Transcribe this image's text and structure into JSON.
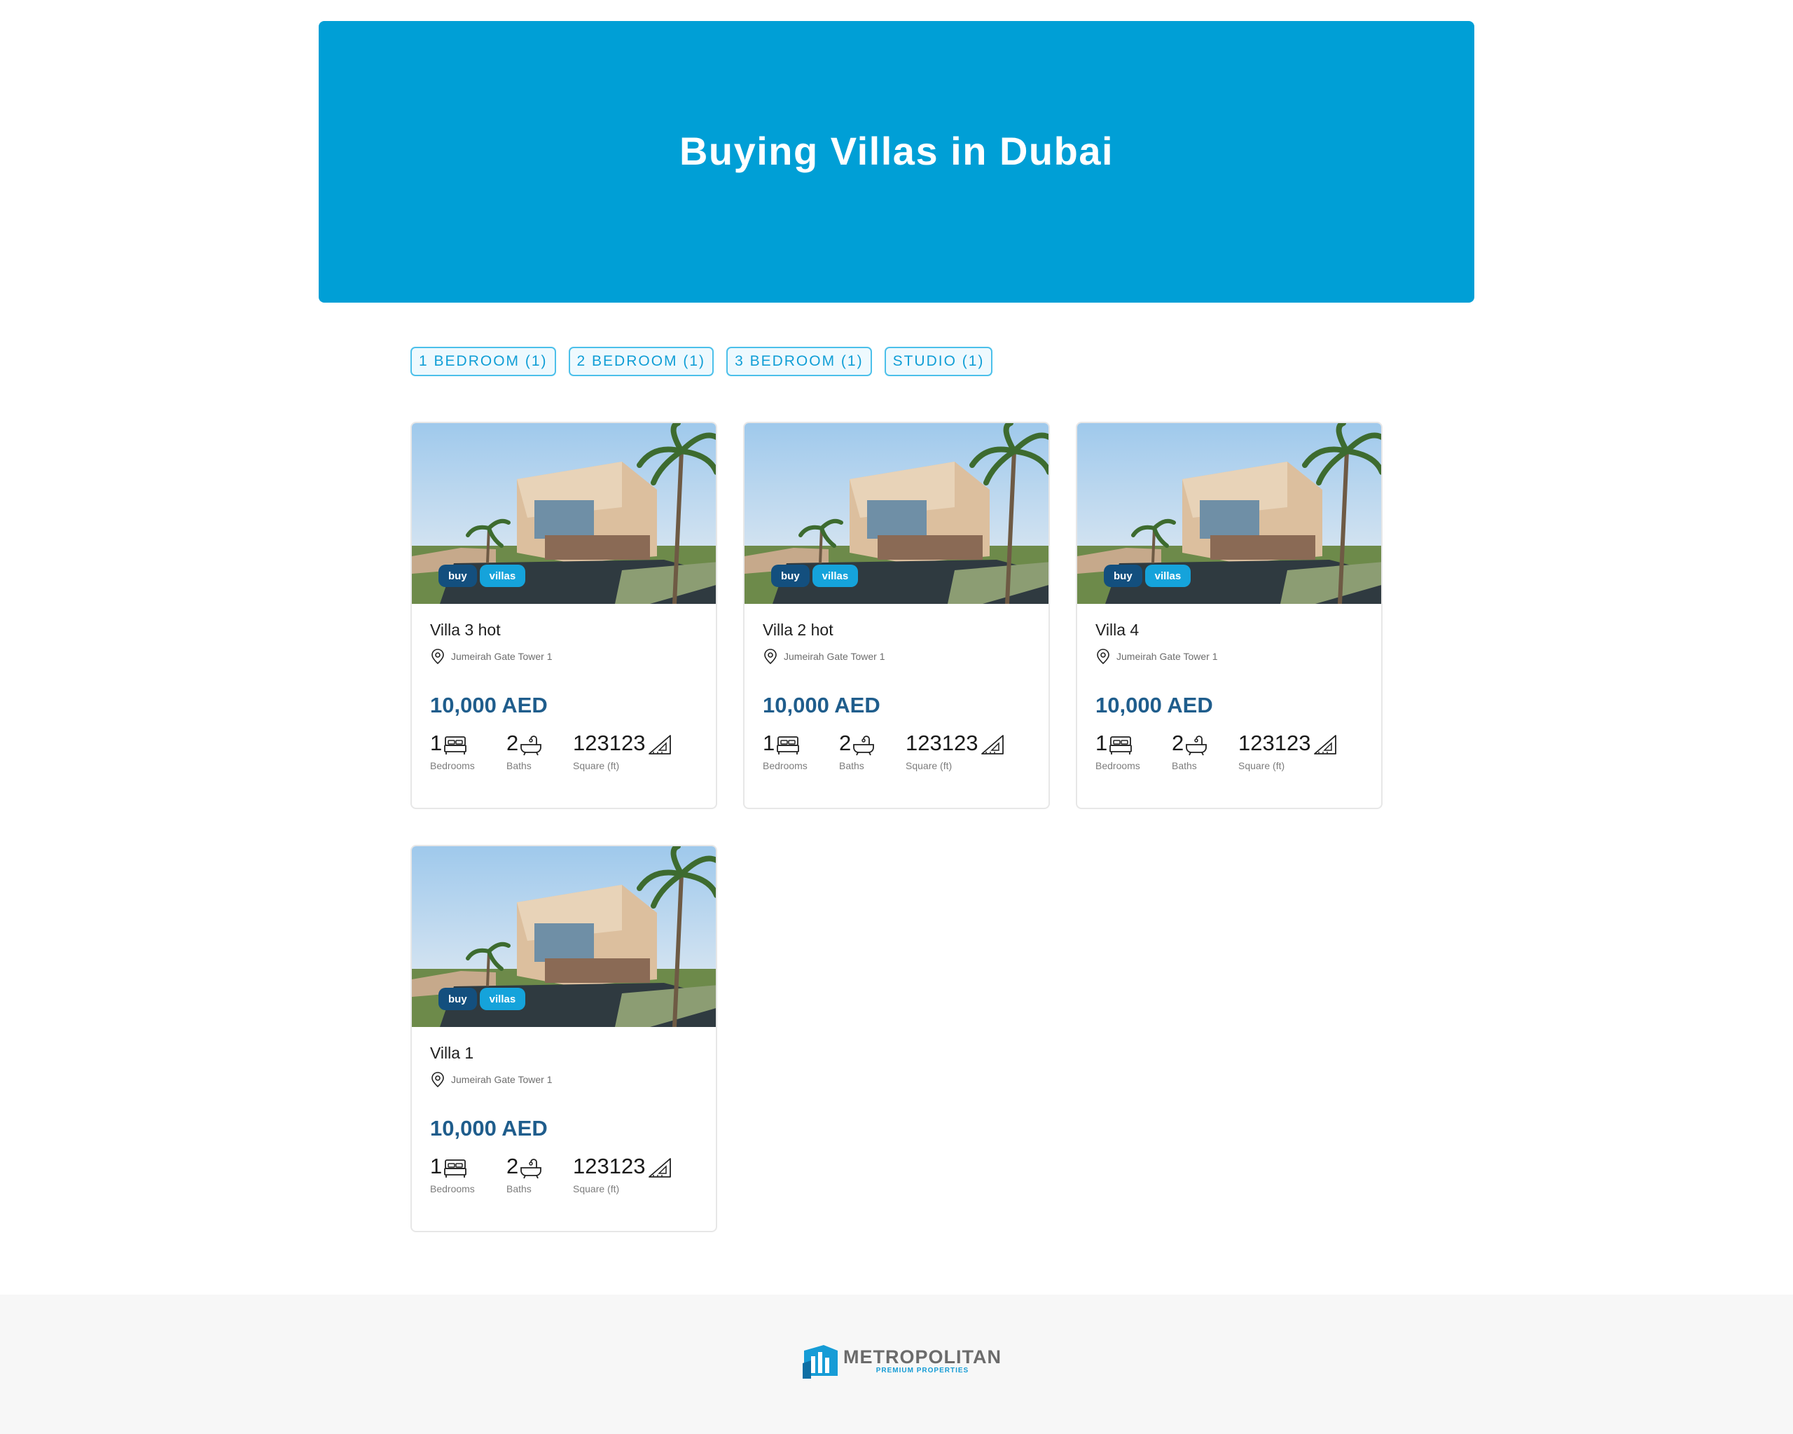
{
  "hero": {
    "title": "Buying Villas in Dubai"
  },
  "filters": [
    {
      "label": "1 BEDROOM (1)"
    },
    {
      "label": "2 BEDROOM (1)"
    },
    {
      "label": "3 BEDROOM (1)"
    },
    {
      "label": "STUDIO (1)"
    }
  ],
  "listings": [
    {
      "title": "Villa 3 hot",
      "tags": [
        "buy",
        "villas"
      ],
      "location": "Jumeirah Gate Tower 1",
      "price": "10,000 AED",
      "bedrooms": "1",
      "baths": "2",
      "area": "123123",
      "bedrooms_label": "Bedrooms",
      "baths_label": "Baths",
      "area_label": "Square (ft)"
    },
    {
      "title": "Villa 2 hot",
      "tags": [
        "buy",
        "villas"
      ],
      "location": "Jumeirah Gate Tower 1",
      "price": "10,000 AED",
      "bedrooms": "1",
      "baths": "2",
      "area": "123123",
      "bedrooms_label": "Bedrooms",
      "baths_label": "Baths",
      "area_label": "Square (ft)"
    },
    {
      "title": "Villa 4",
      "tags": [
        "buy",
        "villas"
      ],
      "location": "Jumeirah Gate Tower 1",
      "price": "10,000 AED",
      "bedrooms": "1",
      "baths": "2",
      "area": "123123",
      "bedrooms_label": "Bedrooms",
      "baths_label": "Baths",
      "area_label": "Square (ft)"
    },
    {
      "title": "Villa 1",
      "tags": [
        "buy",
        "villas"
      ],
      "location": "Jumeirah Gate Tower 1",
      "price": "10,000 AED",
      "bedrooms": "1",
      "baths": "2",
      "area": "123123",
      "bedrooms_label": "Bedrooms",
      "baths_label": "Baths",
      "area_label": "Square (ft)"
    }
  ],
  "footer": {
    "logo_main": "METROPOLITAN",
    "logo_sub": "PREMIUM PROPERTIES"
  },
  "colors": {
    "hero_bg": "#009fd6",
    "price": "#1f5d8c",
    "tag_buy": "#134f7e",
    "tag_villas": "#15a3db",
    "chip_border": "#4cc0ea"
  },
  "icons": {
    "location": "map-pin-icon",
    "bed": "bed-icon",
    "bath": "bathtub-icon",
    "area": "set-square-icon"
  }
}
